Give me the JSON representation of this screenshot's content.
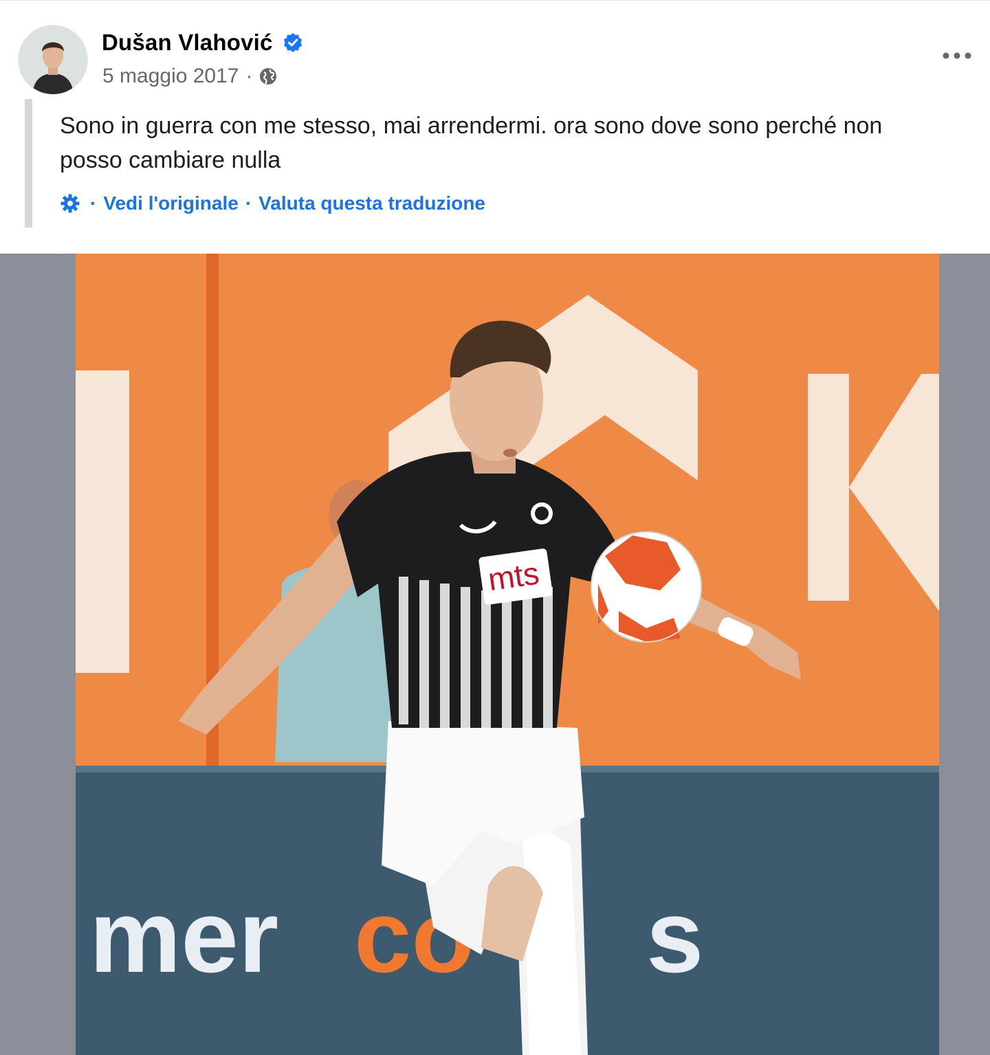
{
  "post": {
    "author": "Dušan Vlahović",
    "date": "5 maggio 2017",
    "meta_separator": "·",
    "text_line1": "Sono in guerra con me stesso, mai arrendermi. ora sono dove sono perché non",
    "text_line2": "posso cambiare nulla",
    "translation": {
      "sep1": "·",
      "see_original": "Vedi l'originale",
      "sep2": "·",
      "rate_translation": "Valuta questa traduzione"
    },
    "photo": {
      "jersey_sponsor": "mts",
      "board_brand": "mer",
      "board_brand_accent": "co",
      "board_brand_end": "s"
    }
  },
  "icons": {
    "verified": "verified-badge-icon",
    "audience": "globe-icon",
    "more": "more-options-icon",
    "translation_settings": "gear-icon"
  },
  "colors": {
    "link_blue": "#1b74e4",
    "verified_blue": "#1877f2",
    "meta_gray": "#65676b",
    "quote_bar": "#d4d6da"
  }
}
